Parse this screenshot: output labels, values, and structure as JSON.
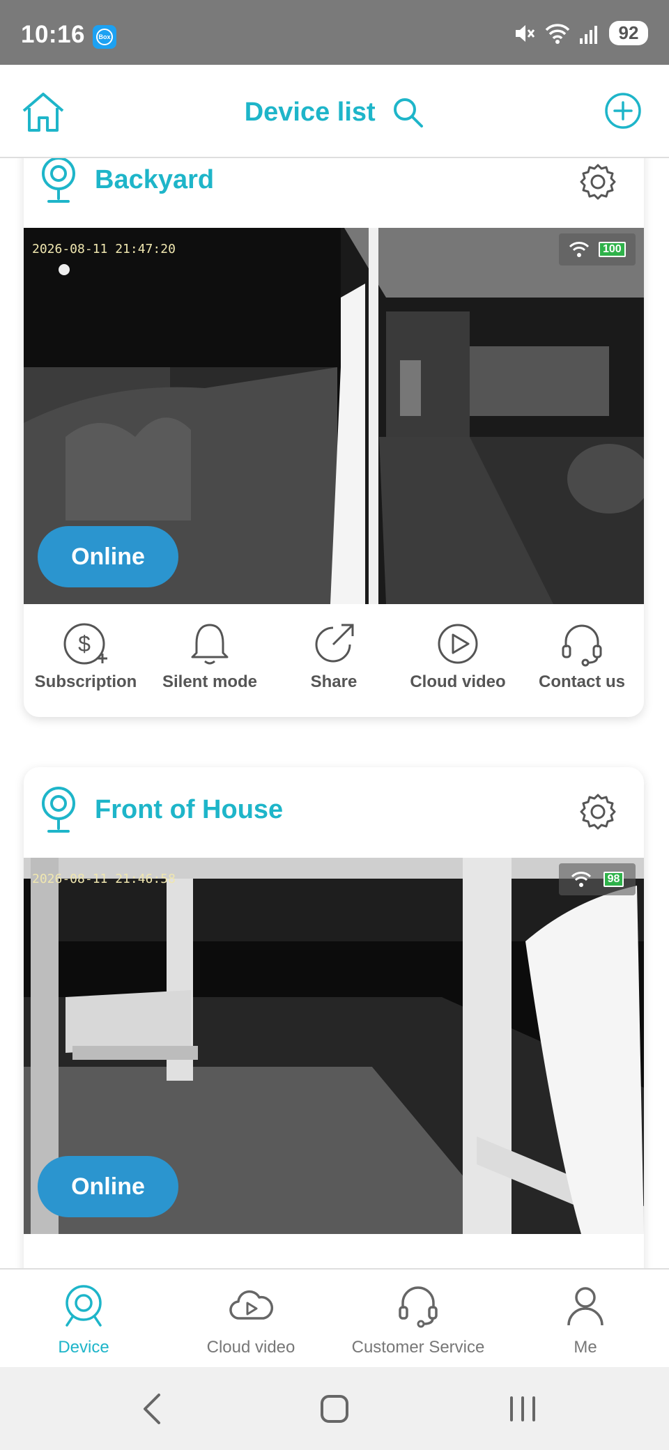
{
  "status_bar": {
    "time": "10:16",
    "notification_badge": "Box",
    "battery": "92",
    "signal_label": "6"
  },
  "header": {
    "title": "Device list"
  },
  "devices": [
    {
      "name": "Backyard",
      "timestamp": "2026-08-11 21:47:20",
      "battery": "100",
      "status": "Online"
    },
    {
      "name": "Front of House",
      "timestamp": "2026-08-11 21:46:58",
      "battery": "98",
      "status": "Online"
    }
  ],
  "actions": [
    {
      "label": "Subscription",
      "icon": "subscription-icon"
    },
    {
      "label": "Silent mode",
      "icon": "bell-icon"
    },
    {
      "label": "Share",
      "icon": "share-icon"
    },
    {
      "label": "Cloud video",
      "icon": "play-circle-icon"
    },
    {
      "label": "Contact us",
      "icon": "headset-icon"
    }
  ],
  "bottom_nav": [
    {
      "label": "Device",
      "icon": "camera-icon",
      "active": true
    },
    {
      "label": "Cloud video",
      "icon": "cloud-play-icon",
      "active": false
    },
    {
      "label": "Customer Service",
      "icon": "headset-icon",
      "active": false
    },
    {
      "label": "Me",
      "icon": "person-icon",
      "active": false
    }
  ],
  "colors": {
    "accent": "#1eb5c9",
    "online": "#2b95cf",
    "status_bar": "#7a7a7a"
  }
}
